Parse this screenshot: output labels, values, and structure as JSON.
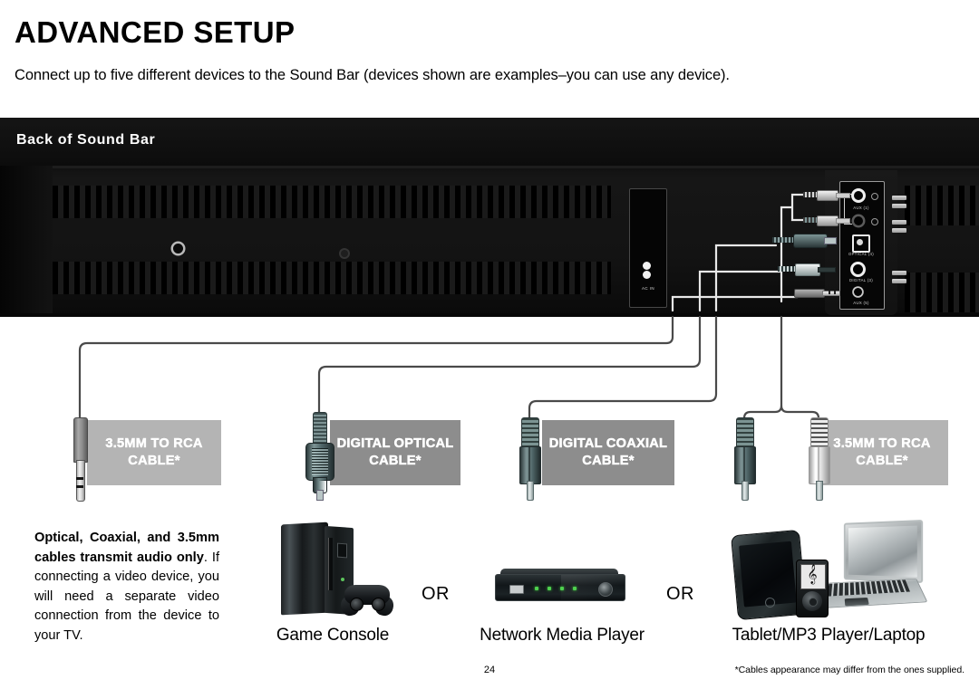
{
  "header": {
    "title": "ADVANCED SETUP",
    "intro": "Connect up to five different devices to the Sound Bar (devices shown are examples–you can use any device)."
  },
  "banner": {
    "label": "Back of Sound Bar"
  },
  "soundbar": {
    "power_label": "AC IN",
    "ports": [
      {
        "name": "aux-in-1",
        "label": "AUX (1)"
      },
      {
        "name": "optical-in",
        "label": "OPTICAL (4)"
      },
      {
        "name": "digital-coax-in",
        "label": "DIGITAL (3)"
      },
      {
        "name": "aux-in-2",
        "label": "AUX (5)"
      }
    ]
  },
  "cables": [
    {
      "name": "cable-35mm-to-rca",
      "label": "3.5MM TO RCA CABLE*",
      "lines": [
        "3.5MM TO RCA",
        "CABLE*"
      ],
      "box_color": "#b4b4b4"
    },
    {
      "name": "cable-digital-optical",
      "label": "DIGITAL OPTICAL CABLE*",
      "lines": [
        "DIGITAL",
        "OPTICAL",
        "CABLE*"
      ],
      "box_color": "#8d8d8d"
    },
    {
      "name": "cable-digital-coaxial",
      "label": "DIGITAL COAXIAL CABLE*",
      "lines": [
        "DIGITAL",
        "COAXIAL",
        "CABLE*"
      ],
      "box_color": "#8d8d8d"
    },
    {
      "name": "cable-35mm-to-rca-right",
      "label": "3.5MM TO RCA CABLE*",
      "lines": [
        "3.5MM TO",
        "RCA CABLE*"
      ],
      "box_color": "#b4b4b4"
    }
  ],
  "note": {
    "bold": "Optical, Coaxial, and 3.5mm cables transmit audio only",
    "rest": ". If connecting a video device, you will need a separate video connection from the device to your TV."
  },
  "devices": [
    {
      "name": "game-console",
      "caption": "Game Console"
    },
    {
      "name": "network-media-player",
      "caption": "Network Media Player"
    },
    {
      "name": "tablet-mp3-laptop",
      "caption": "Tablet/MP3 Player/Laptop"
    }
  ],
  "separators": {
    "or": "OR"
  },
  "footer": {
    "page_number": "24",
    "footnote": "*Cables appearance may differ from the ones supplied."
  }
}
